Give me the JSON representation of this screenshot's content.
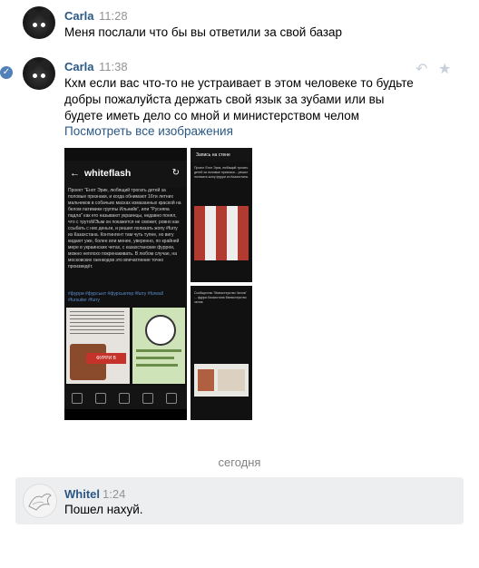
{
  "messages": [
    {
      "author": "Carla",
      "time": "11:28",
      "text": "Меня послали что бы вы ответили за свой базар"
    },
    {
      "author": "Carla",
      "time": "11:38",
      "text_lines": [
        "Кхм если вас что-то не устраивает в этом человеке то будьте",
        "добры пожалуйста держать свой язык за зубами или вы",
        "будете иметь дело со мной и министерством челом"
      ],
      "link": "Посмотреть все изображения",
      "screenshot_main": {
        "title": "whiteflash",
        "body": "Проект \"Енот Эрик, любящий трогать детей за половые признаки, и когда обнимают 16ти летних мальчиков в собачьих масках измазанных краской на белом патимике группы Ильнийк\", или \"Русняяа падла\" как его называют украинцы, недавно понял, что с трутоМЭым он покажется не сможет, ровно как ссыбать с них деньги, и решил полизать жопу #furry из Казахстана. Контингент там чуть тупее, но вигу кидают уже, более или менее, уверенно, по крайней мере в украинских четах, с казахстанские фурреи, можно неплохо покренакивать. В любом случае, на московских гаенкодов это впечатление точно произведёт.",
        "tags": "#фурри #фурсьют #фурсьютер #furry #furwall #fursuiter #furry",
        "tabs": [
          "Главная",
          "Сервисы",
          "Мессенджер",
          "Клипы",
          "Видео"
        ]
      },
      "screenshot_top_right": {
        "title": "Запись на стене",
        "body": "Проект Енот Эрик, любящий трогать детей за половые признаки... решил полизать жопу фурри из Казахстана."
      },
      "screenshot_bottom_right": {
        "body": "Сообщество \"Министерство Челов\" ... фурри Казахстана Министерство челов"
      }
    },
    {
      "author": "Whitel",
      "time": "1:24",
      "text": "Пошел нахуй."
    }
  ],
  "date_divider": "сегодня",
  "colors": {
    "author": "#2a5885",
    "time": "#939393",
    "link": "#2a5885",
    "highlight": "#edeef0",
    "verified": "#5181b8"
  },
  "icons": {
    "verified": "checkmark-icon",
    "reply": "reply-arrow-icon",
    "favorite": "star-icon"
  }
}
